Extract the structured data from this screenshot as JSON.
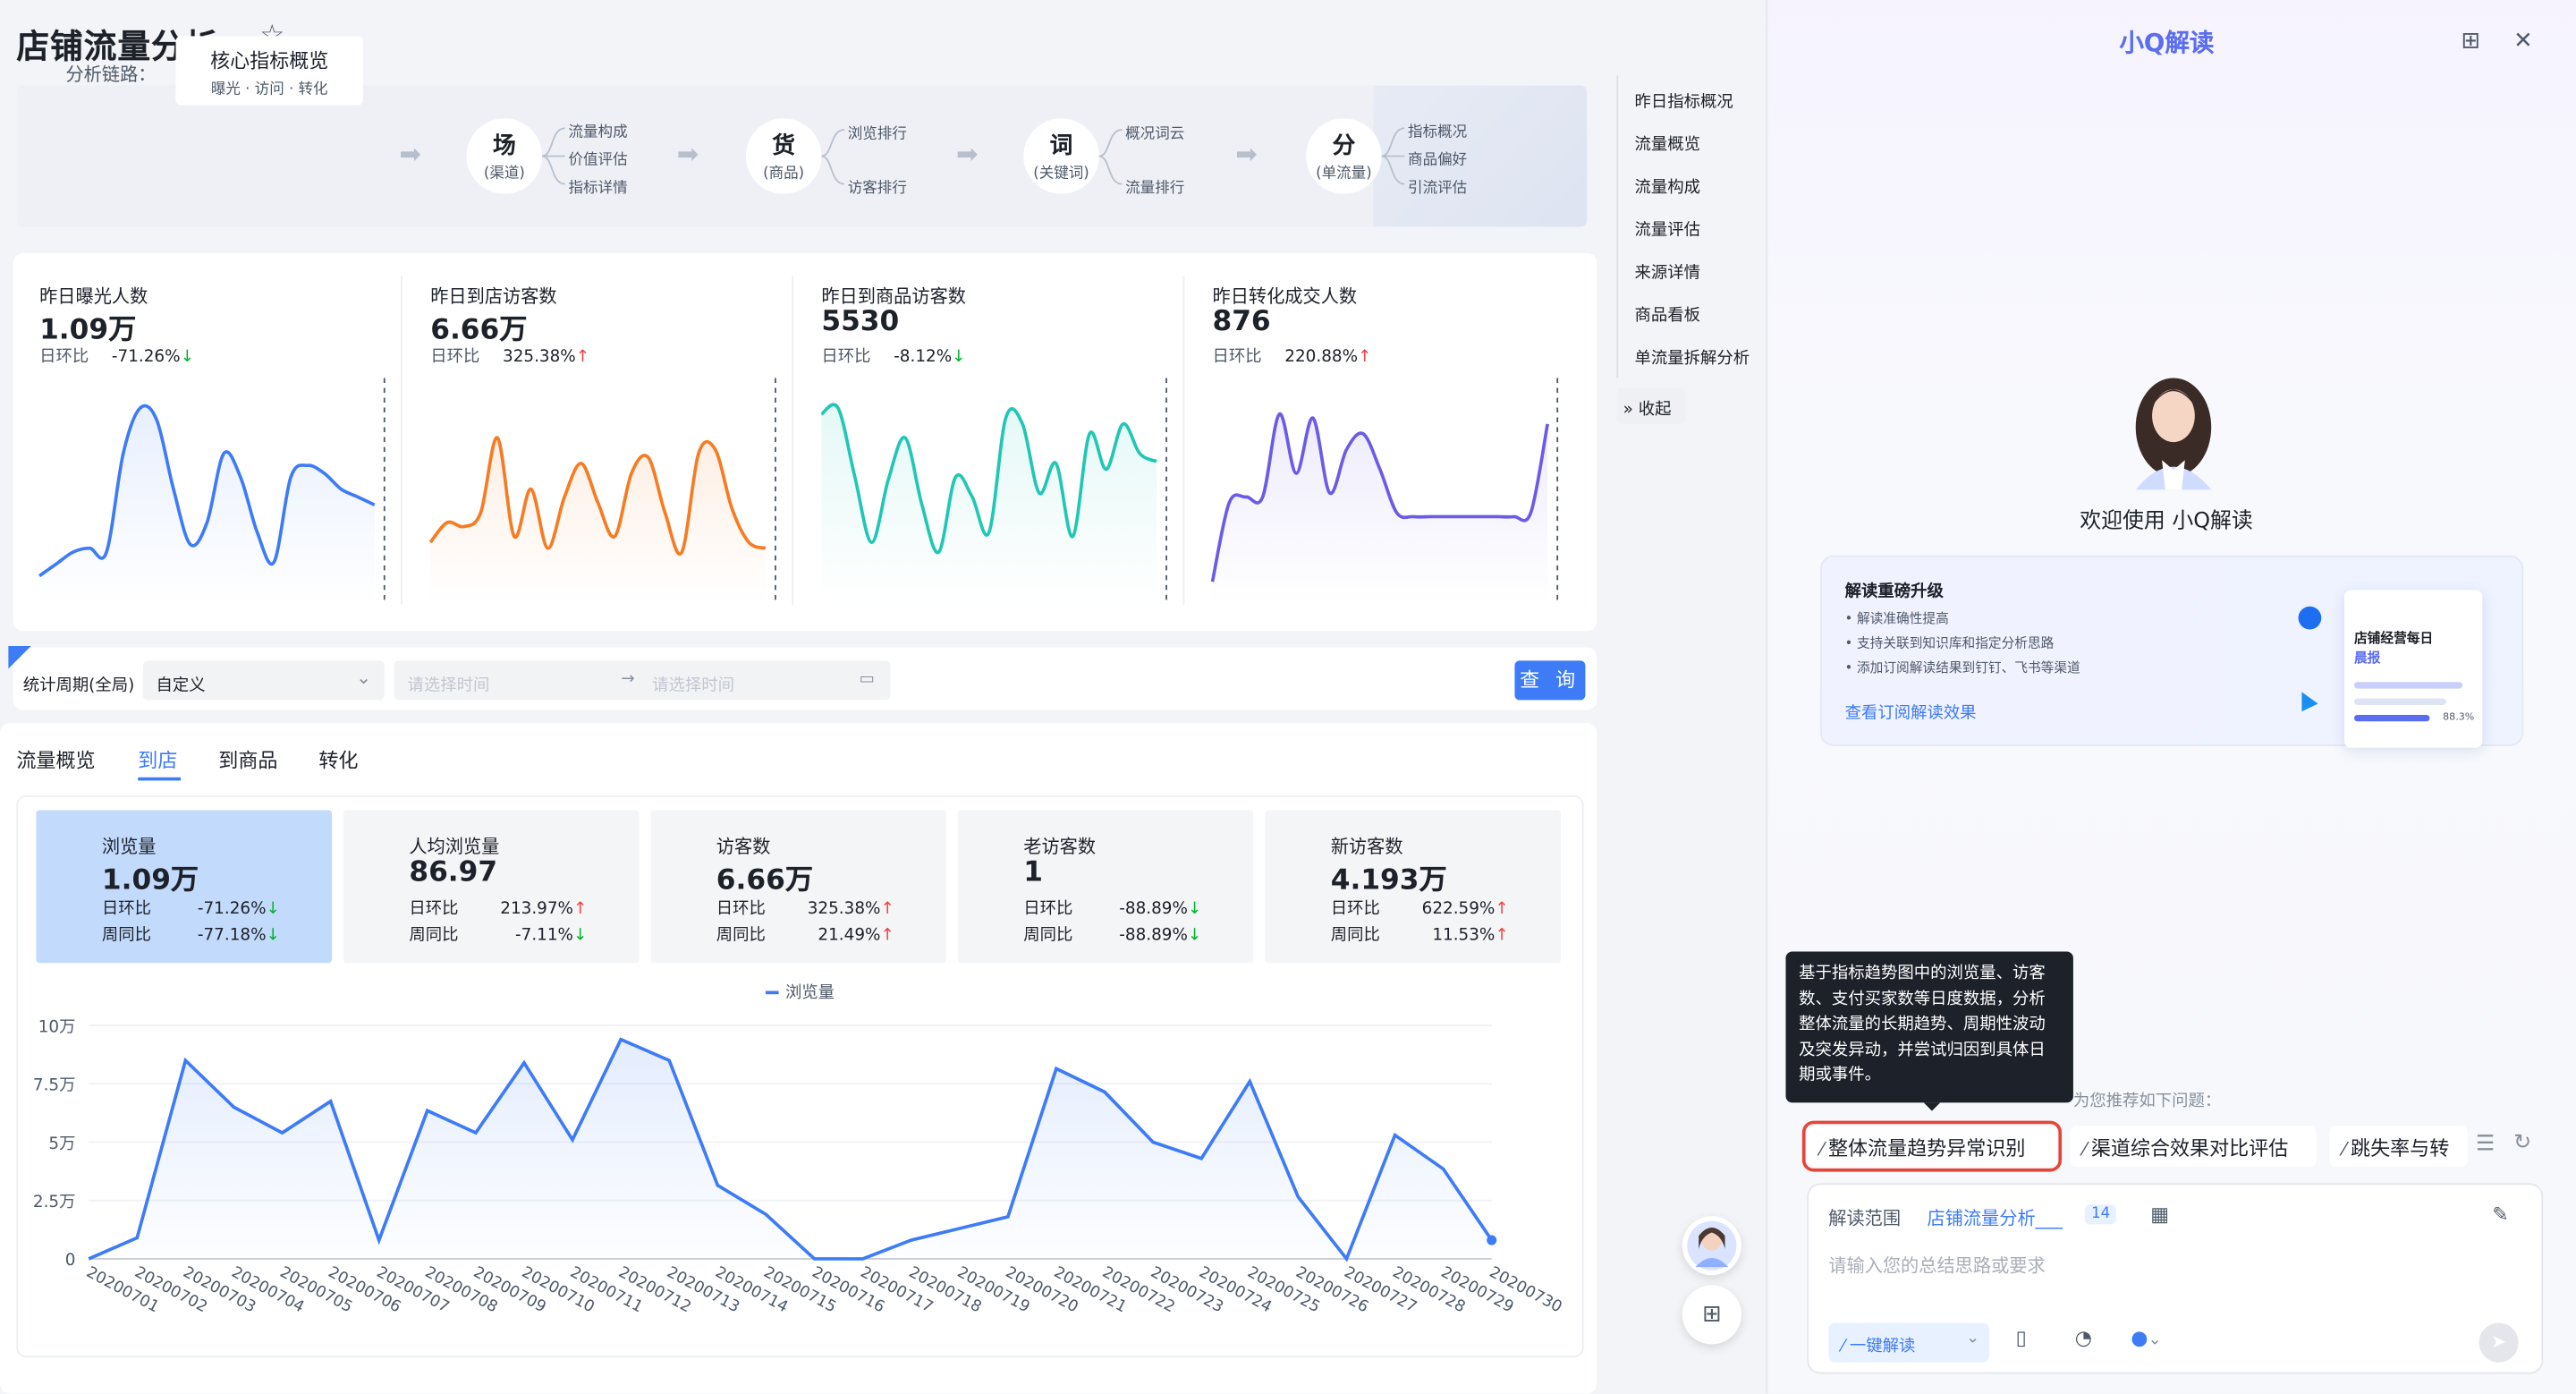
{
  "page": {
    "title": "店铺流量分析___"
  },
  "chain": {
    "label": "分析链路：",
    "core": {
      "title": "核心指标概览",
      "sub": "曝光 · 访问 · 转化"
    },
    "nodes": [
      {
        "title": "场",
        "sub": "(渠道)",
        "branches": [
          "流量构成",
          "价值评估",
          "指标详情"
        ]
      },
      {
        "title": "货",
        "sub": "(商品)",
        "branches": [
          "浏览排行",
          "访客排行"
        ]
      },
      {
        "title": "词",
        "sub": "(关键词)",
        "branches": [
          "概况词云",
          "流量排行"
        ]
      },
      {
        "title": "分",
        "sub": "(单流量)",
        "branches": [
          "指标概况",
          "商品偏好",
          "引流评估"
        ]
      }
    ]
  },
  "metrics": [
    {
      "label": "昨日曝光人数",
      "value": "1.09万",
      "cmp_label": "日环比",
      "change": "-71.26%",
      "dir": "down",
      "color": "#3d7bf7",
      "points": [
        8,
        14,
        20,
        22,
        20,
        70,
        93,
        87,
        52,
        24,
        35,
        70,
        58,
        30,
        15,
        58,
        64,
        60,
        52,
        48,
        44
      ]
    },
    {
      "label": "昨日到店访客数",
      "value": "6.66万",
      "cmp_label": "日环比",
      "change": "325.38%",
      "dir": "up",
      "color": "#f77b22",
      "points": [
        25,
        35,
        33,
        40,
        78,
        28,
        52,
        22,
        48,
        65,
        45,
        28,
        60,
        68,
        40,
        20,
        70,
        72,
        42,
        25,
        22
      ]
    },
    {
      "label": "昨日到商品访客数",
      "value": "5530",
      "cmp_label": "日环比",
      "change": "-8.12%",
      "dir": "down",
      "color": "#21c7b5",
      "points": [
        90,
        93,
        58,
        25,
        57,
        78,
        44,
        20,
        58,
        48,
        30,
        88,
        85,
        50,
        65,
        28,
        80,
        62,
        85,
        70,
        66
      ]
    },
    {
      "label": "昨日转化成交人数",
      "value": "876",
      "cmp_label": "日环比",
      "change": "220.88%",
      "dir": "up",
      "color": "#6b5be6",
      "points": [
        5,
        45,
        48,
        48,
        90,
        60,
        88,
        50,
        72,
        80,
        62,
        40,
        38,
        38,
        38,
        38,
        38,
        38,
        38,
        40,
        85
      ]
    }
  ],
  "filter": {
    "label": "统计周期(全局)",
    "select": "自定义",
    "start_placeholder": "请选择时间",
    "end_placeholder": "请选择时间",
    "query": "查 询"
  },
  "tabs": [
    "流量概览",
    "到店",
    "到商品",
    "转化"
  ],
  "active_tab": 1,
  "kpis": [
    {
      "name": "浏览量",
      "value": "1.09万",
      "r1l": "日环比",
      "r1v": "-71.26%",
      "r1d": "down",
      "r2l": "周同比",
      "r2v": "-77.18%",
      "r2d": "down",
      "selected": true
    },
    {
      "name": "人均浏览量",
      "value": "86.97",
      "r1l": "日环比",
      "r1v": "213.97%",
      "r1d": "up",
      "r2l": "周同比",
      "r2v": "-7.11%",
      "r2d": "down"
    },
    {
      "name": "访客数",
      "value": "6.66万",
      "r1l": "日环比",
      "r1v": "325.38%",
      "r1d": "up",
      "r2l": "周同比",
      "r2v": "21.49%",
      "r2d": "up"
    },
    {
      "name": "老访客数",
      "value": "1",
      "r1l": "日环比",
      "r1v": "-88.89%",
      "r1d": "down",
      "r2l": "周同比",
      "r2v": "-88.89%",
      "r2d": "down"
    },
    {
      "name": "新访客数",
      "value": "4.193万",
      "r1l": "日环比",
      "r1v": "622.59%",
      "r1d": "up",
      "r2l": "周同比",
      "r2v": "11.53%",
      "r2d": "up"
    }
  ],
  "chart_data": {
    "type": "line",
    "series": [
      {
        "name": "浏览量",
        "color": "#3d7bf7"
      }
    ],
    "categories": [
      "20200701",
      "20200702",
      "20200703",
      "20200704",
      "20200705",
      "20200706",
      "20200707",
      "20200708",
      "20200709",
      "20200710",
      "20200711",
      "20200712",
      "20200713",
      "20200714",
      "20200715",
      "20200716",
      "20200717",
      "20200718",
      "20200719",
      "20200720",
      "20200721",
      "20200722",
      "20200723",
      "20200724",
      "20200725",
      "20200726",
      "20200727",
      "20200728",
      "20200729",
      "20200730"
    ],
    "values": [
      0,
      1800,
      17000,
      13000,
      10800,
      13500,
      1600,
      12700,
      10800,
      16800,
      10200,
      18800,
      17000,
      6300,
      3800,
      0,
      0,
      1600,
      2600,
      3600,
      16300,
      14300,
      10000,
      8600,
      15200,
      5300,
      0,
      10600,
      7700,
      1600
    ],
    "yticks": [
      "0",
      "2.5万",
      "5万",
      "7.5万",
      "10万"
    ],
    "ylim": [
      0,
      20000
    ]
  },
  "right_nav": {
    "items": [
      "昨日指标概况",
      "流量概览",
      "流量构成",
      "流量评估",
      "来源详情",
      "商品看板",
      "单流量拆解分析"
    ],
    "collapse": "收起"
  },
  "panel": {
    "title": "小Q解读",
    "welcome": "欢迎使用 小Q解读",
    "upgrade": {
      "title": "解读重磅升级",
      "bullets": [
        "解读准确性提高",
        "支持关联到知识库和指定分析思路",
        "添加订阅解读结果到钉钉、飞书等渠道"
      ],
      "link": "查看订阅解读效果",
      "mock_title": "店铺经营每日",
      "mock_sub": "晨报",
      "mock_pct": "88.3%"
    },
    "tooltip": "基于指标趋势图中的浏览量、访客数、支付买家数等日度数据，分析整体流量的长期趋势、周期性波动及突发异动，并尝试归因到具体日期或事件。",
    "hint": "为您推荐如下问题：",
    "chips": [
      "整体流量趋势异常识别",
      "渠道综合效果对比评估",
      "跳失率与转"
    ],
    "input": {
      "scope_label": "解读范围",
      "scope_link": "店铺流量分析___",
      "scope_count": "14",
      "placeholder": "请输入您的总结思路或要求",
      "action": "一键解读"
    }
  }
}
